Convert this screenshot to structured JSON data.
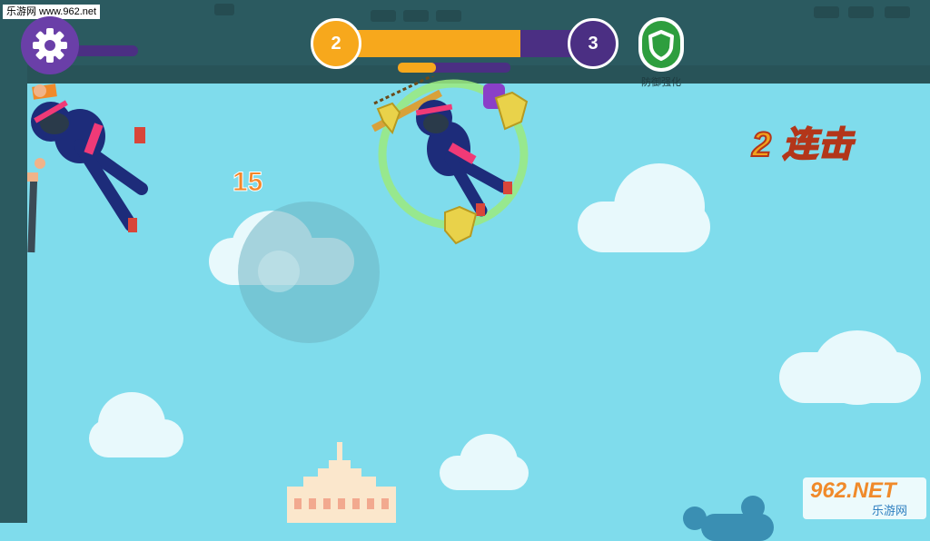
{
  "watermark_top": "乐游网 www.962.net",
  "level": {
    "current": "2",
    "next": "3",
    "progress": 0.72,
    "sub_progress": 0.34
  },
  "defense": {
    "label": "防御强化",
    "icon": "shield-icon"
  },
  "combo_text": "2 连击",
  "score": "15",
  "watermark_bottom": {
    "line1": "962.NET",
    "line2": "乐游网"
  },
  "colors": {
    "sky": "#7fdcec",
    "wall": "#2b5a60",
    "orange": "#f7a81c",
    "purple": "#4b2f83",
    "green": "#2e9e3e"
  }
}
